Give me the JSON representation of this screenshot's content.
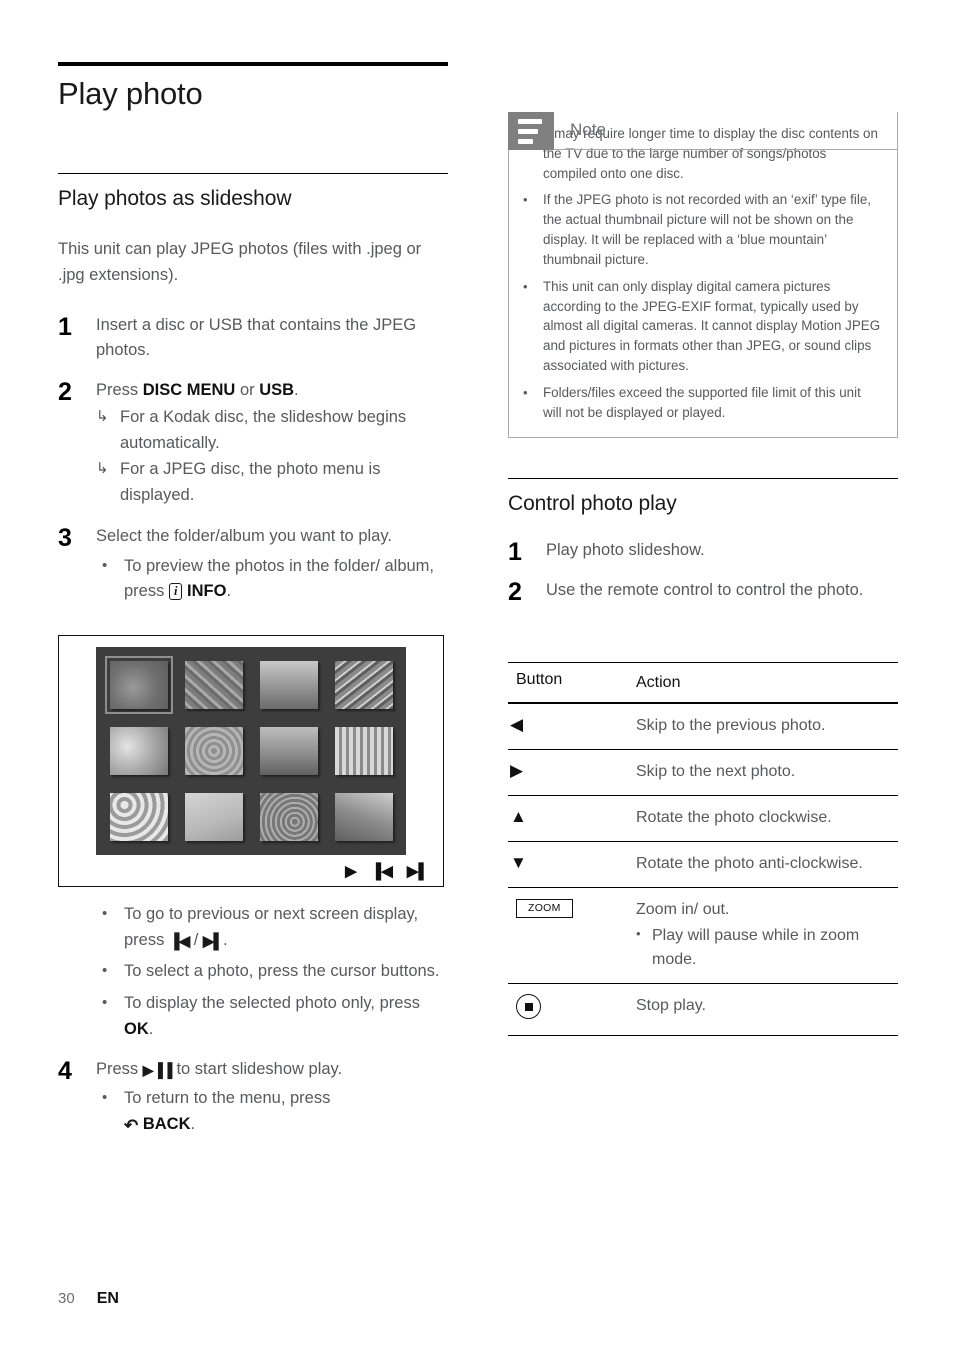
{
  "left": {
    "title": "Play photo",
    "section_heading": "Play photos as slideshow",
    "intro": "This unit can play JPEG photos (files with .jpeg or .jpg extensions).",
    "steps": [
      {
        "num": "1",
        "text": "Insert a disc or USB that contains the JPEG photos."
      },
      {
        "num": "2",
        "text_pre": "Press ",
        "bold1": "DISC MENU",
        "text_mid": " or ",
        "bold2": "USB",
        "text_post": ".",
        "arrows": [
          "For a Kodak disc, the slideshow begins automatically.",
          "For a JPEG disc, the photo menu is displayed."
        ]
      },
      {
        "num": "3",
        "text": "Select the folder/album you want to play.",
        "bullet_pre": "To preview the photos in the folder/ album, press ",
        "bullet_icon": "i",
        "bullet_bold": "INFO",
        "bullet_post": "."
      },
      {
        "num": "4",
        "text_pre": "Press ",
        "icon": "▶▐▐",
        "text_post": " to start slideshow play.",
        "bullet_pre": "To return to the menu, press ",
        "bullet_icon": "↶",
        "bullet_bold": "BACK",
        "bullet_post": "."
      }
    ],
    "after_image_bullets": [
      {
        "pre": "To go to previous or next screen display, press ",
        "icon1": "▐◀",
        "sep": " / ",
        "icon2": "▶▌",
        "post": "."
      },
      {
        "pre": "To select a photo, press the cursor buttons.",
        "icon1": "",
        "sep": "",
        "icon2": "",
        "post": ""
      },
      {
        "pre": "To display the selected photo only, press ",
        "icon1": "",
        "sep": "",
        "icon2": "",
        "bold": "OK",
        "post": "."
      }
    ],
    "tv_screenshot": {
      "controls": [
        "▶",
        "▐◀",
        "▶▌"
      ],
      "thumbnail_count": 12,
      "selected_index": 0,
      "background_color": "#3d3d3d"
    }
  },
  "note": {
    "title": "Note",
    "icon": "note-lines-icon",
    "icon_color": "#808080",
    "items": [
      "It may require longer time to display the disc contents on the TV due to the large number of songs/photos compiled onto one disc.",
      "If the JPEG photo is not recorded with an ‘exif’ type file, the actual thumbnail picture will not be shown on the display.  It will be replaced with a ‘blue mountain’ thumbnail picture.",
      "This unit can only display digital camera pictures according to the JPEG-EXIF format, typically used by almost all digital cameras.  It cannot display Motion JPEG and pictures in formats other than JPEG, or sound clips associated with pictures.",
      "Folders/files exceed the supported file limit of this unit will not be displayed or played."
    ]
  },
  "right": {
    "section_heading": "Control photo play",
    "steps": [
      {
        "num": "1",
        "text": "Play photo slideshow."
      },
      {
        "num": "2",
        "text": "Use the remote control to control the photo."
      }
    ],
    "table": {
      "headers": [
        "Button",
        "Action"
      ],
      "rows": [
        {
          "button_icon": "◀",
          "button_type": "glyph",
          "action": "Skip to the previous photo.",
          "sub": ""
        },
        {
          "button_icon": "▶",
          "button_type": "glyph",
          "action": "Skip to the next photo.",
          "sub": ""
        },
        {
          "button_icon": "▲",
          "button_type": "glyph",
          "action": "Rotate the photo clockwise.",
          "sub": ""
        },
        {
          "button_icon": "▼",
          "button_type": "glyph",
          "action": "Rotate the photo anti-clockwise.",
          "sub": ""
        },
        {
          "button_icon": "ZOOM",
          "button_type": "boxed-label",
          "action": "Zoom in/ out.",
          "sub": "Play will pause while in zoom mode."
        },
        {
          "button_icon": "stop-circle",
          "button_type": "stop-icon",
          "action": "Stop play.",
          "sub": ""
        }
      ]
    }
  },
  "footer": {
    "page_number": "30",
    "language": "EN"
  }
}
